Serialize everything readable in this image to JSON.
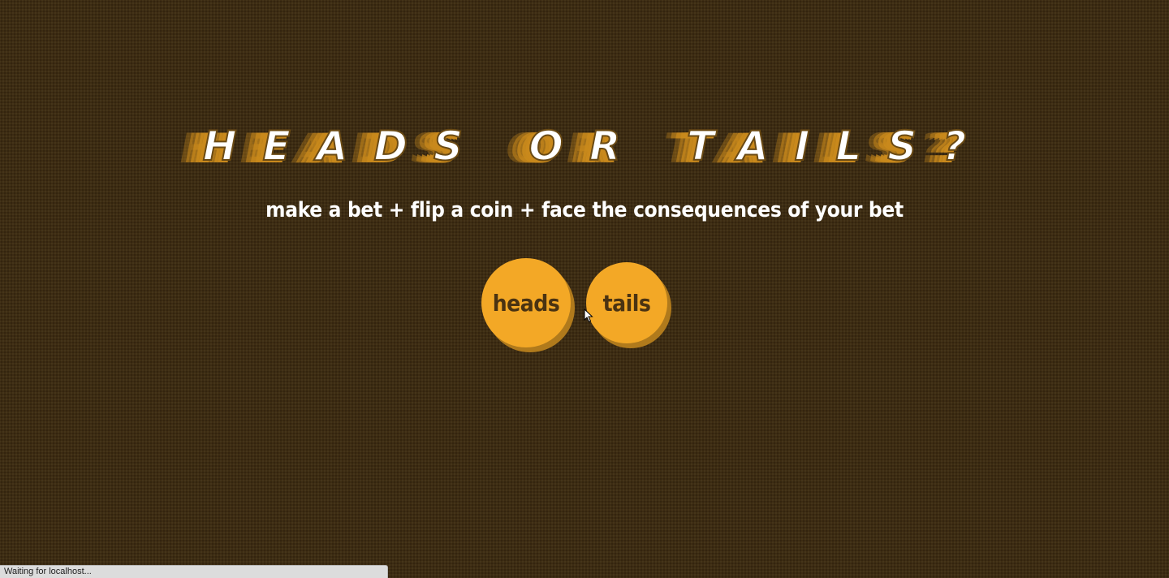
{
  "title": "HEADS OR TAILS?",
  "subtitle": "make a bet + flip a coin + face the consequences of your bet",
  "buttons": {
    "heads_label": "heads",
    "tails_label": "tails"
  },
  "status_bar": {
    "text": "Waiting for localhost..."
  },
  "colors": {
    "background": "#3d2c12",
    "coin": "#f3a826",
    "coin_shadow": "#b07a1c",
    "coin_text": "#4a3312",
    "title_text": "#ffffff",
    "title_streak": "#c9891c"
  },
  "icons": {
    "cursor": "mouse-pointer-icon"
  }
}
